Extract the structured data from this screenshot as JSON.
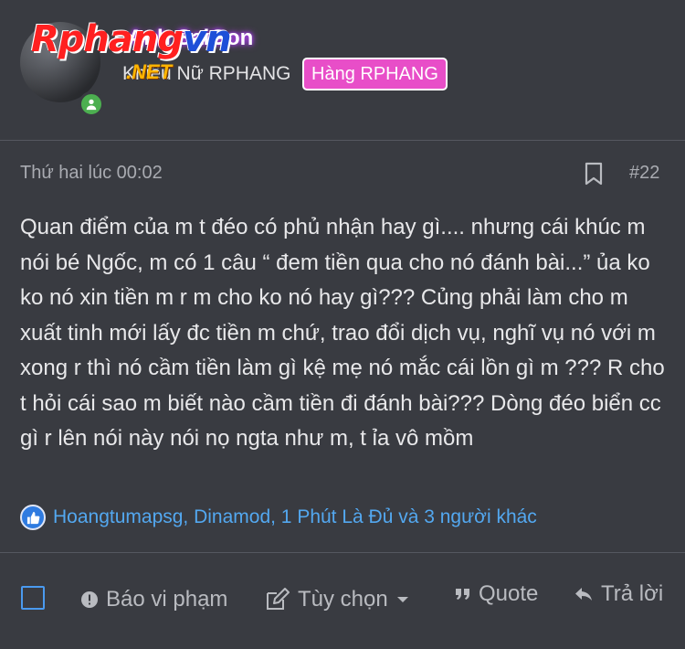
{
  "author": {
    "username": "Anh SaiGon",
    "title": "Khiêu Nữ RPHANG",
    "rank_badge": "Hàng RPHANG",
    "logo_main": "Rphang",
    "logo_vn": "vn",
    "logo_net": ".NET"
  },
  "post": {
    "date": "Thứ hai lúc 00:02",
    "number": "#22",
    "body": "Quan điểm của m t đéo có phủ nhận hay gì.... nhưng cái khúc m nói bé Ngốc, m có 1 câu “ đem tiền qua cho nó đánh bài...” ủa ko ko nó xin tiền m r m cho ko nó hay gì??? Củng phải làm cho m xuất tinh mới lấy đc tiền m chứ, trao đổi dịch vụ, nghĩ vụ nó với m xong r thì nó cầm tiền làm gì kệ mẹ nó mắc cái lồn gì m ??? R cho t hỏi cái sao m biết nào cầm tiền đi đánh bài??? Dòng đéo biển cc gì r lên nói này nói nọ ngta như m, t ỉa vô mồm"
  },
  "reactions": {
    "text": "Hoangtumapsg, Dinamod, 1 Phút Là Đủ và 3 người khác"
  },
  "actions": {
    "report": "Báo vi phạm",
    "options": "Tùy chọn",
    "quote": "Quote",
    "reply": "Trả lời"
  },
  "colors": {
    "background": "#393b41",
    "badge": "#e84ec8",
    "link": "#53a8f0",
    "online": "#4caf50"
  }
}
